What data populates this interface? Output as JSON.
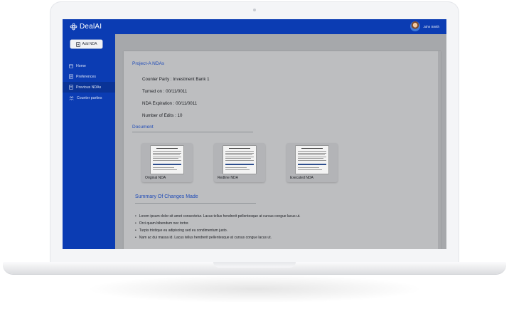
{
  "app": {
    "brand": "DealAI",
    "user_name": "John Smith"
  },
  "sidebar": {
    "add_button": "Add NDA",
    "items": [
      {
        "label": "Home",
        "icon": "home-icon",
        "active": false
      },
      {
        "label": "Preferences",
        "icon": "preferences-icon",
        "active": false
      },
      {
        "label": "Previous NDAs",
        "icon": "document-icon",
        "active": true
      },
      {
        "label": "Counter parties",
        "icon": "people-icon",
        "active": false
      }
    ]
  },
  "project": {
    "title": "Project-A NDAs",
    "counter_party": "Counter Party : Investment Bank 1",
    "turned_on": "Turned on : 00/11/0011",
    "expiration": "NDA Expiration : 00/11/0011",
    "edits": "Number of Edits : 10"
  },
  "documents": {
    "heading": "Document",
    "items": [
      {
        "label": "Original  NDA"
      },
      {
        "label": "Redline NDA"
      },
      {
        "label": "Executed NDA"
      }
    ]
  },
  "summary": {
    "heading": "Summary  Of Changes Made",
    "bullets": [
      "Lorem ipsum dolor sit amet consectetur. Lacus tellus hendrerit pellentesque at cursus congue lacus ut.",
      "Orci quam bibendum nec tortor.",
      "Turpis tristique eu adipiscing sed eu condimentum justo.",
      "Nam ac dui massa id.  Lacus tellus hendrerit pellentesque at cursus congue lacus ut."
    ]
  },
  "colors": {
    "brand_blue": "#0b3cb3",
    "heading_blue": "#1f4bb8",
    "overlay_gray": "#bdbec0"
  }
}
